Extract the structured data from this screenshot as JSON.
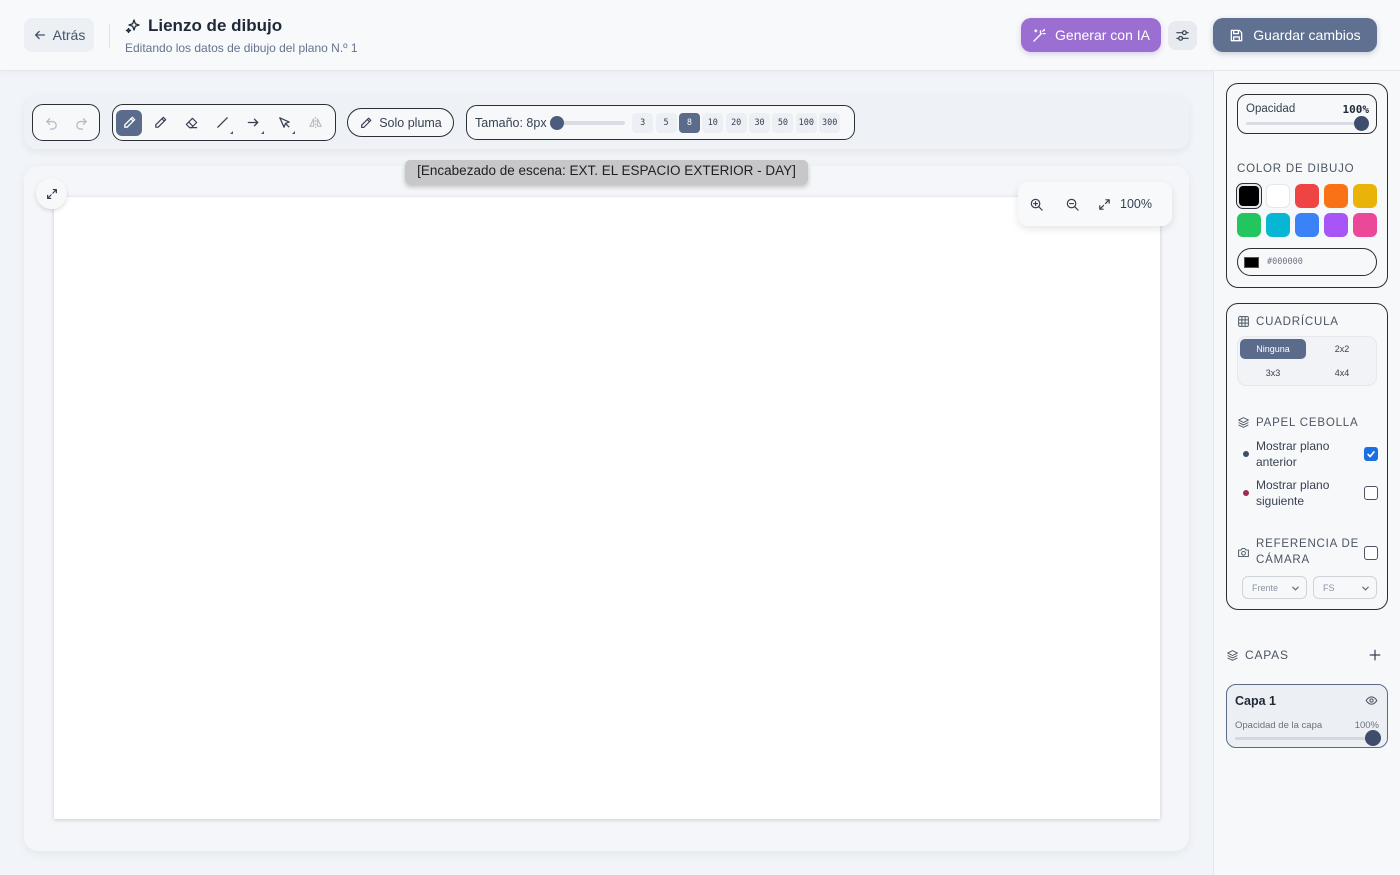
{
  "header": {
    "back_label": "Atrás",
    "title": "Lienzo de dibujo",
    "subtitle": "Editando los datos de dibujo del plano N.º 1",
    "ai_label": "Generar con IA",
    "save_label": "Guardar cambios",
    "colors": {
      "ai": "#9b6fd1",
      "save": "#5f7090"
    }
  },
  "toolbar": {
    "history_icons": [
      "undo-icon",
      "redo-icon"
    ],
    "tools": [
      {
        "icon": "pen-icon",
        "active": true
      },
      {
        "icon": "pencil-icon",
        "active": false
      },
      {
        "icon": "eraser-icon",
        "active": false
      },
      {
        "icon": "line-icon",
        "active": false
      },
      {
        "icon": "arrow-icon",
        "active": false
      },
      {
        "icon": "select-icon",
        "active": false
      },
      {
        "icon": "flip-icon",
        "active": false
      }
    ],
    "pen_only_label": "Solo pluma",
    "size_label": "Tamaño: 8px",
    "size_options": [
      "3",
      "5",
      "8",
      "10",
      "20",
      "30",
      "50",
      "100",
      "300"
    ],
    "size_selected": "8"
  },
  "canvas": {
    "scene_heading": "[Encabezado de escena: EXT. EL ESPACIO EXTERIOR - DAY]",
    "zoom_value": "100%"
  },
  "side_panel": {
    "opacity_label": "Opacidad",
    "opacity_value": "100%",
    "opacity_level": 1.0,
    "color_title": "COLOR DE DIBUJO",
    "colors": [
      "#000000",
      "#ffffff",
      "#ef4444",
      "#f97316",
      "#eab308",
      "#22c55e",
      "#06b6d4",
      "#3b82f6",
      "#a855f7",
      "#ec4899"
    ],
    "selected_color": "#000000",
    "hex_value": "#000000",
    "grid_title": "CUADRÍCULA",
    "grid_options": [
      "Ninguna",
      "2x2",
      "3x3",
      "4x4"
    ],
    "grid_selected": "Ninguna",
    "onion_title": "PAPEL CEBOLLA",
    "onion_prev_label": "Mostrar plano anterior",
    "onion_prev_checked": true,
    "onion_next_label": "Mostrar plano siguiente",
    "onion_next_checked": false,
    "camera_title": "REFERENCIA DE CÁMARA",
    "camera_checked": false,
    "camera_angle": "Frente",
    "camera_shot": "FS",
    "layers_title": "CAPAS",
    "layers": [
      {
        "name": "Capa 1",
        "opacity_label": "Opacidad de la capa",
        "opacity_value": "100%",
        "opacity_level": 1.0
      }
    ]
  }
}
